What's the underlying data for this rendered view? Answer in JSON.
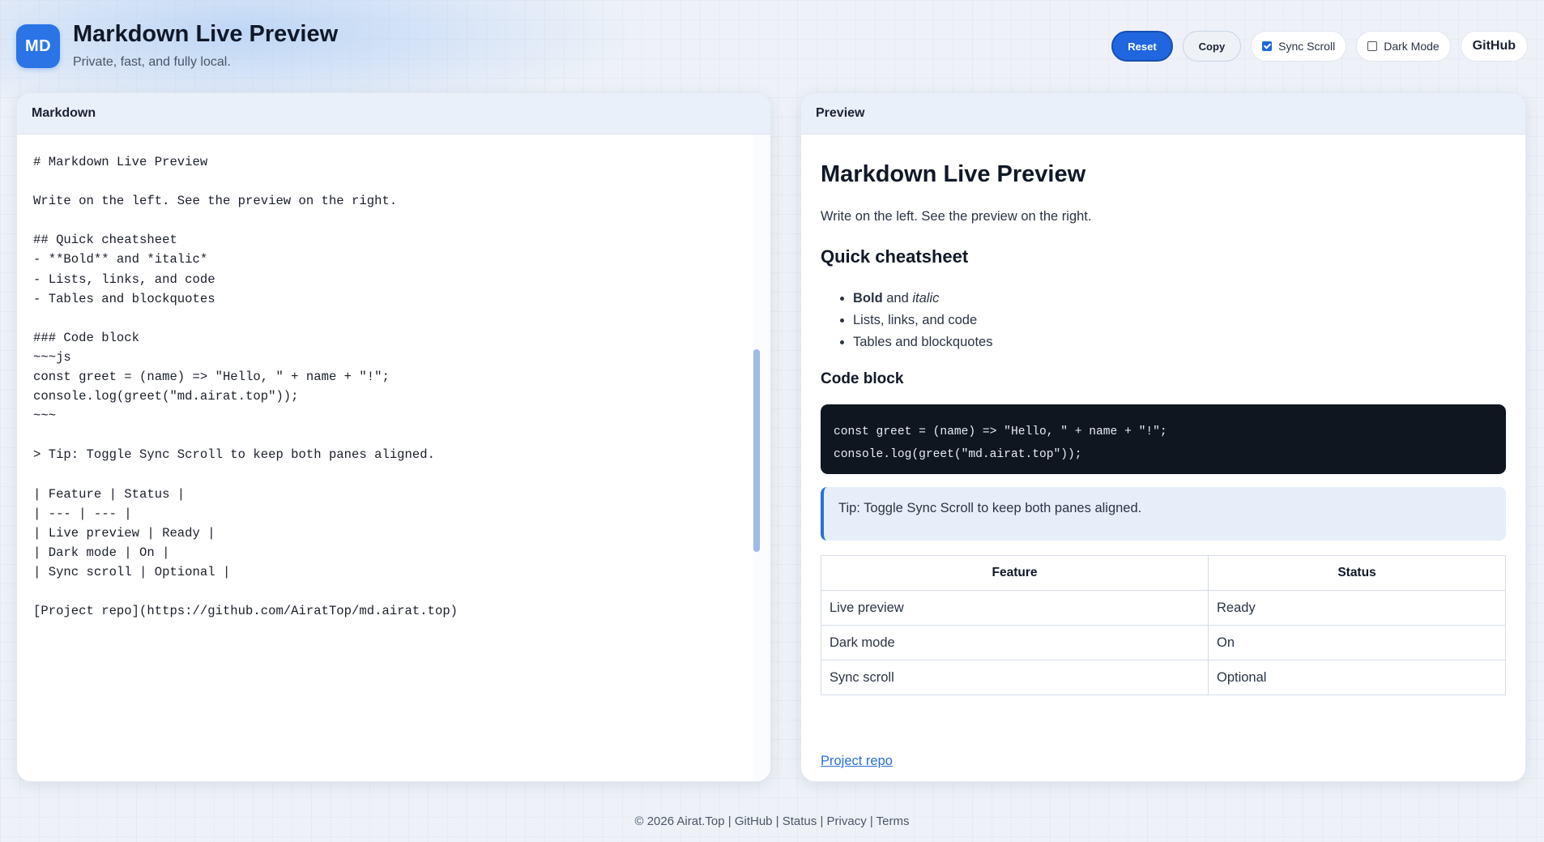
{
  "header": {
    "logo_text": "MD",
    "title": "Markdown Live Preview",
    "subtitle": "Private, fast, and fully local.",
    "reset_label": "Reset",
    "copy_label": "Copy",
    "sync_scroll_label": "Sync Scroll",
    "sync_scroll_checked": true,
    "dark_mode_label": "Dark Mode",
    "dark_mode_checked": false,
    "github_label": "GitHub",
    "accent_color": "#1f66df"
  },
  "editor": {
    "title": "Markdown",
    "content": "# Markdown Live Preview\n\nWrite on the left. See the preview on the right.\n\n## Quick cheatsheet\n- **Bold** and *italic*\n- Lists, links, and code\n- Tables and blockquotes\n\n### Code block\n~~~js\nconst greet = (name) => \"Hello, \" + name + \"!\";\nconsole.log(greet(\"md.airat.top\"));\n~~~\n\n> Tip: Toggle Sync Scroll to keep both panes aligned.\n\n| Feature | Status |\n| --- | --- |\n| Live preview | Ready |\n| Dark mode | On |\n| Sync scroll | Optional |\n\n[Project repo](https://github.com/AiratTop/md.airat.top)"
  },
  "preview": {
    "title": "Preview",
    "h1": "Markdown Live Preview",
    "intro": "Write on the left. See the preview on the right.",
    "h2": "Quick cheatsheet",
    "list": {
      "item1_bold": "Bold",
      "item1_mid": " and ",
      "item1_italic": "italic",
      "item2": "Lists, links, and code",
      "item3": "Tables and blockquotes"
    },
    "h3": "Code block",
    "code": "const greet = (name) => \"Hello, \" + name + \"!\";\nconsole.log(greet(\"md.airat.top\"));",
    "quote": "Tip: Toggle Sync Scroll to keep both panes aligned.",
    "table": {
      "headers": [
        "Feature",
        "Status"
      ],
      "rows": [
        [
          "Live preview",
          "Ready"
        ],
        [
          "Dark mode",
          "On"
        ],
        [
          "Sync scroll",
          "Optional"
        ]
      ]
    },
    "link_text": "Project repo"
  },
  "footer": {
    "copyright": "© 2026 Airat.Top",
    "sep": " | ",
    "github": "GitHub",
    "status": "Status",
    "privacy": "Privacy",
    "terms": "Terms"
  }
}
